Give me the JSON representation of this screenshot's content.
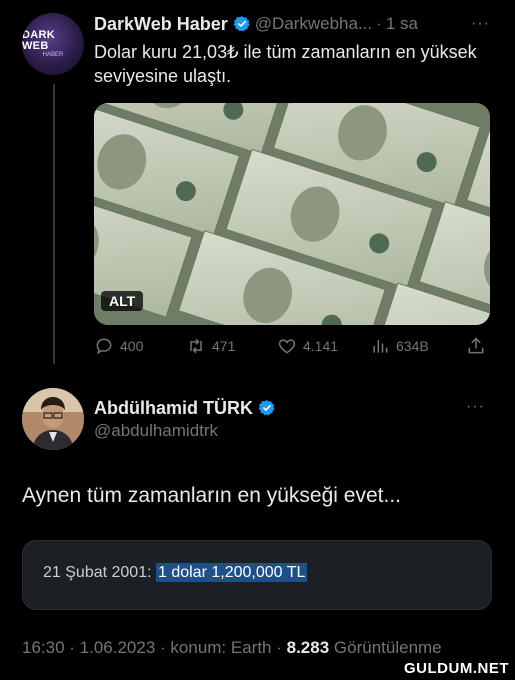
{
  "tweet1": {
    "avatar_logo": {
      "main": "DARK WEB",
      "sub": "HABER"
    },
    "name": "DarkWeb Haber",
    "handle": "@Darkwebha...",
    "separator": "·",
    "time": "1 sa",
    "more": "···",
    "text": "Dolar kuru 21,03₺ ile tüm zamanların en yüksek seviyesine ulaştı.",
    "media": {
      "alt_badge": "ALT",
      "description_icon": "dollar-bills-image"
    },
    "actions": {
      "replies": "400",
      "retweets": "471",
      "likes": "4.141",
      "views": "634B"
    }
  },
  "tweet2": {
    "name": "Abdülhamid TÜRK",
    "handle": "@abdulhamidtrk",
    "more": "···",
    "text": "Aynen tüm zamanların en yükseği evet...",
    "quote": {
      "prefix": "21 Şubat 2001: ",
      "highlight": "1 dolar 1,200,000 TL"
    },
    "meta": {
      "time": "16:30",
      "date": "1.06.2023",
      "location": "konum: Earth",
      "views_count": "8.283",
      "views_label": "Görüntülenme",
      "sep": " · "
    }
  },
  "watermark": "GULDUM.NET",
  "colors": {
    "background": "#000000",
    "text": "#e7e9ea",
    "muted": "#71767b",
    "verified": "#1d9bf0",
    "highlight": "#1d4f8a",
    "card": "#1c1f23"
  }
}
